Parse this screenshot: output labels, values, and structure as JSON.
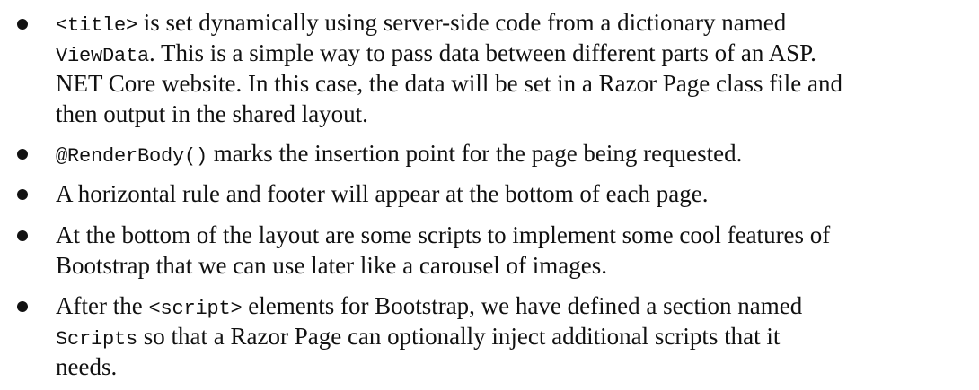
{
  "bullets": [
    {
      "lines": [
        [
          {
            "code": "<title>"
          },
          {
            "text": " is set dynamically using server-side code from a dictionary named"
          }
        ],
        [
          {
            "code": "ViewData"
          },
          {
            "text": ". This is a simple way to pass data between different parts of an ASP."
          }
        ],
        [
          {
            "text": "NET Core website. In this case, the data will be set in a Razor Page class file and"
          }
        ],
        [
          {
            "text": "then output in the shared layout."
          }
        ]
      ]
    },
    {
      "lines": [
        [
          {
            "code": "@RenderBody()"
          },
          {
            "text": " marks the insertion point for the page being requested."
          }
        ]
      ]
    },
    {
      "lines": [
        [
          {
            "text": "A horizontal rule and footer will appear at the bottom of each page."
          }
        ]
      ]
    },
    {
      "lines": [
        [
          {
            "text": "At the bottom of the layout are some scripts to implement some cool features of"
          }
        ],
        [
          {
            "text": "Bootstrap that we can use later like a carousel of images."
          }
        ]
      ]
    },
    {
      "lines": [
        [
          {
            "text": "After the "
          },
          {
            "code": "<script>"
          },
          {
            "text": " elements for Bootstrap, we have defined a section named"
          }
        ],
        [
          {
            "code": "Scripts"
          },
          {
            "text": " so that a Razor Page can optionally inject additional scripts that it"
          }
        ],
        [
          {
            "text": "needs."
          }
        ]
      ]
    }
  ]
}
